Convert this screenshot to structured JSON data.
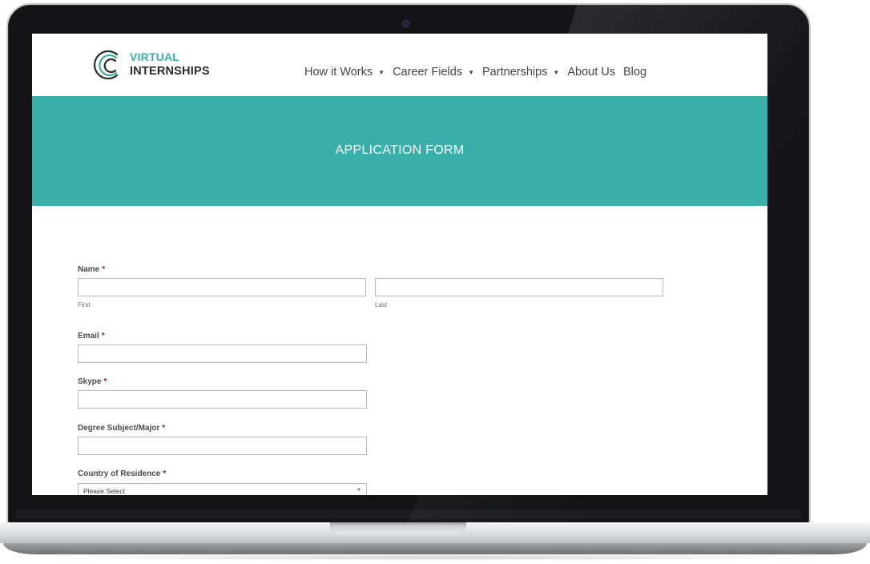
{
  "site": {
    "logo": {
      "line1": "VIRTUAL",
      "line2": "INTERNSHIPS"
    },
    "nav": [
      {
        "label": "How it Works",
        "dropdown": true
      },
      {
        "label": "Career Fields",
        "dropdown": true
      },
      {
        "label": "Partnerships",
        "dropdown": true
      },
      {
        "label": "About Us",
        "dropdown": false
      },
      {
        "label": "Blog",
        "dropdown": false
      }
    ],
    "dropdown_caret": "▼"
  },
  "hero": {
    "title": "APPLICATION FORM"
  },
  "form": {
    "required_marker": "*",
    "name": {
      "label": "Name",
      "first_sublabel": "First",
      "last_sublabel": "Last",
      "first_value": "",
      "last_value": ""
    },
    "email": {
      "label": "Email",
      "value": ""
    },
    "skype": {
      "label": "Skype",
      "value": ""
    },
    "degree": {
      "label": "Degree Subject/Major",
      "value": ""
    },
    "country": {
      "label": "Country of Residence",
      "selected": "Please Select"
    }
  },
  "colors": {
    "accent_teal": "#3aaea8",
    "required_red": "#9b1c1c",
    "laptop_bezel": "#141416"
  },
  "icons": {
    "logo_mark": "concentric-arcs-logo-icon",
    "camera": "webcam-dot-icon",
    "select_arrow": "triangle-down-icon"
  }
}
